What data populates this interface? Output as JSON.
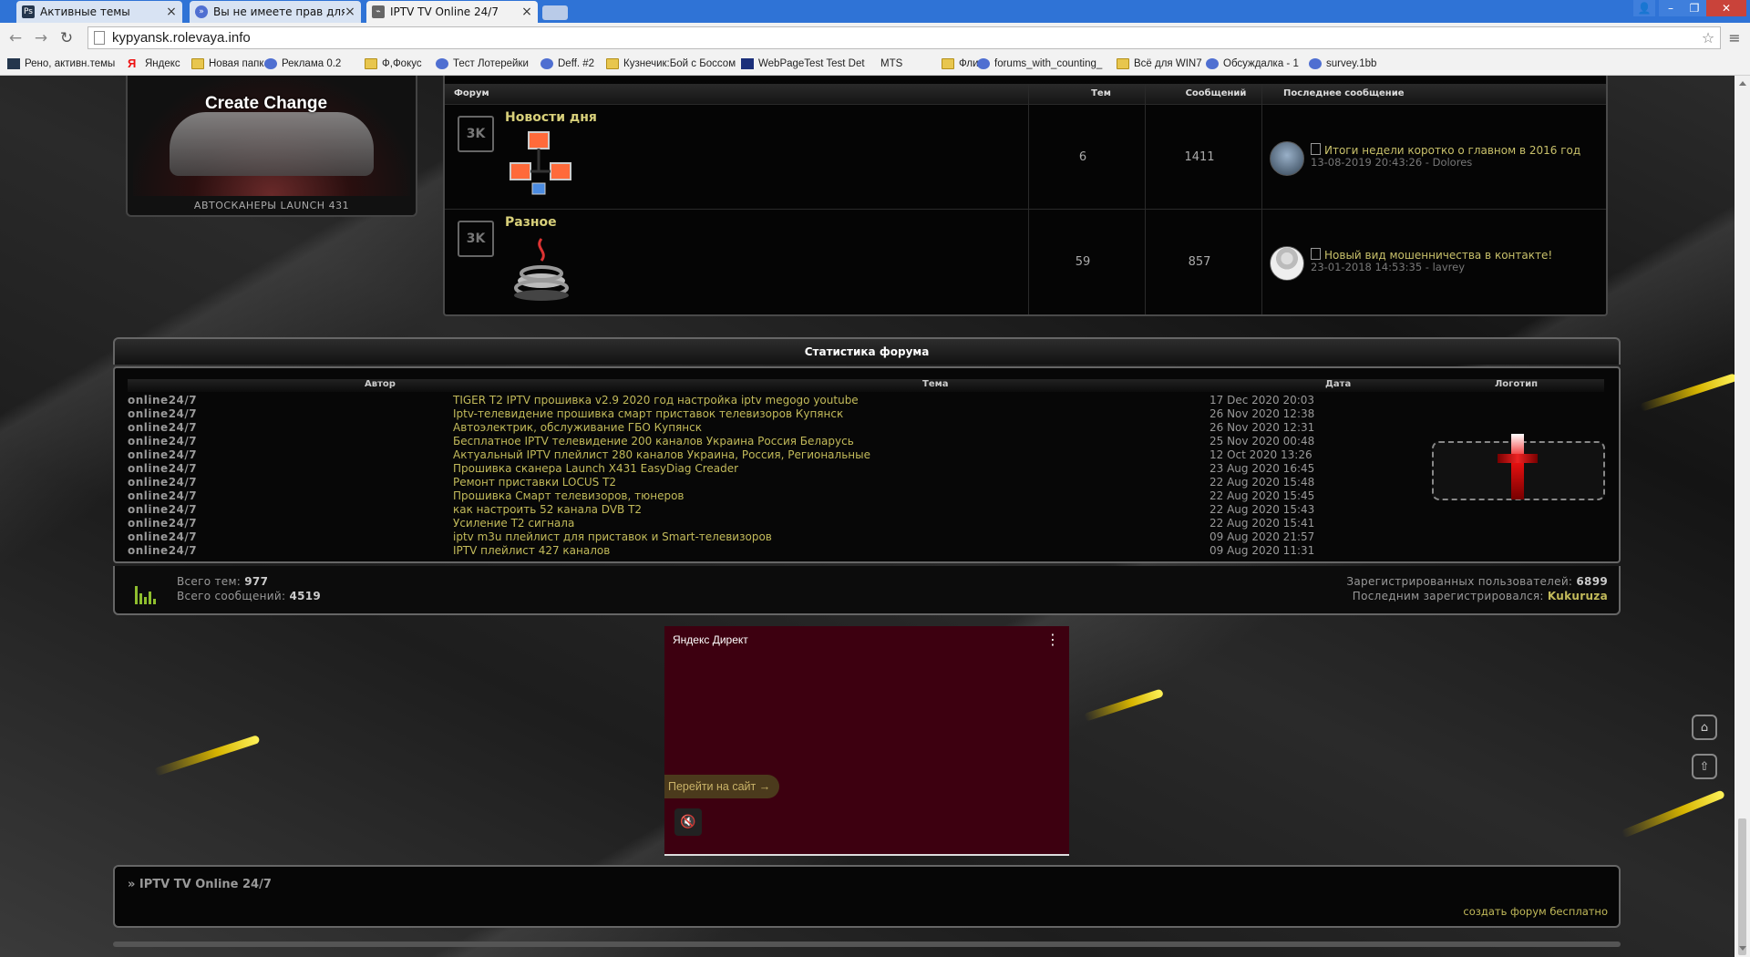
{
  "browser": {
    "tabs": [
      {
        "title": "Активные темы",
        "favicon": "ps-icon",
        "active": false
      },
      {
        "title": "Вы не имеете прав для дос",
        "favicon": "proxy-icon",
        "active": false
      },
      {
        "title": "IPTV TV Online 24/7",
        "favicon": "satellite-icon",
        "active": true
      }
    ],
    "url": "kypyansk.rolevaya.info",
    "bookmarks": [
      {
        "label": "Рено, активн.темы",
        "icon": "ps"
      },
      {
        "label": "Яндекс",
        "icon": "ya"
      },
      {
        "label": "Новая папка",
        "icon": "folder"
      },
      {
        "label": "Реклама 0.2",
        "icon": "proxy"
      },
      {
        "label": "Ф,Фокус",
        "icon": "folder"
      },
      {
        "label": "Тест Лотерейки",
        "icon": "proxy"
      },
      {
        "label": "Deff. #2",
        "icon": "proxy"
      },
      {
        "label": "Кузнечик:Бой с Боссом",
        "icon": "folder"
      },
      {
        "label": "WebPageTest Test Det",
        "icon": "wpt"
      },
      {
        "label": "MTS",
        "icon": "page"
      },
      {
        "label": "Фли",
        "icon": "folder"
      },
      {
        "label": "forums_with_counting_",
        "icon": "proxy"
      },
      {
        "label": "Всё для WIN7",
        "icon": "folder"
      },
      {
        "label": "Обсуждалка - 1",
        "icon": "proxy"
      },
      {
        "label": "survey.1bb",
        "icon": "proxy"
      }
    ]
  },
  "widget": {
    "caption": "Create Change",
    "subtitle": "АВТОСКАНЕРЫ LAUNCH 431"
  },
  "forum_table": {
    "headers": {
      "forum": "Форум",
      "topics": "Тем",
      "posts": "Сообщений",
      "last": "Последнее сообщение"
    },
    "rows": [
      {
        "name": "Новости дня",
        "icon_badge": "3K",
        "topics": "6",
        "posts": "1411",
        "last_title": "Итоги недели коротко о главном в 2016 год",
        "last_meta": "13-08-2019 20:43:26 - Dolores"
      },
      {
        "name": "Разное",
        "icon_badge": "3K",
        "topics": "59",
        "posts": "857",
        "last_title": "Новый вид мошенничества в контакте!",
        "last_meta": "23-01-2018 14:53:35 - lavrey"
      }
    ]
  },
  "stats": {
    "title": "Статистика форума",
    "headers": {
      "author": "Автор",
      "topic": "Тема",
      "date": "Дата",
      "logo": "Логотип"
    },
    "rows": [
      {
        "author": "online24/7",
        "topic": "TIGER T2 IPTV прошивка v2.9 2020 год настройка iptv megogo youtube",
        "date": "17 Dec 2020 20:03"
      },
      {
        "author": "online24/7",
        "topic": "Iptv-телевидение прошивка смарт приставок телевизоров Купянск",
        "date": "26 Nov 2020 12:38"
      },
      {
        "author": "online24/7",
        "topic": "Автоэлектрик, обслуживание ГБО Купянск",
        "date": "26 Nov 2020 12:31"
      },
      {
        "author": "online24/7",
        "topic": "Бесплатное IPTV телевидение 200 каналов Украина Россия Беларусь",
        "date": "25 Nov 2020 00:48"
      },
      {
        "author": "online24/7",
        "topic": "Актуальный IPTV плейлист 280 каналов Украина, Россия, Региональные",
        "date": "12 Oct 2020 13:26"
      },
      {
        "author": "online24/7",
        "topic": "Прошивка сканера Launch X431 EasyDiag Creader",
        "date": "23 Aug 2020 16:45"
      },
      {
        "author": "online24/7",
        "topic": "Ремонт приставки LOCUS T2",
        "date": "22 Aug 2020 15:48"
      },
      {
        "author": "online24/7",
        "topic": "Прошивка Смарт телевизоров, тюнеров",
        "date": "22 Aug 2020 15:45"
      },
      {
        "author": "online24/7",
        "topic": "как настроить 52 канала DVB T2",
        "date": "22 Aug 2020 15:43"
      },
      {
        "author": "online24/7",
        "topic": "Усиление Т2 сигнала",
        "date": "22 Aug 2020 15:41"
      },
      {
        "author": "online24/7",
        "topic": "iptv m3u плейлист для приставок и Smart-телевизоров",
        "date": "09 Aug 2020 21:57"
      },
      {
        "author": "online24/7",
        "topic": "IPTV плейлист 427 каналов",
        "date": "09 Aug 2020 11:31"
      }
    ],
    "totals": {
      "topics_label": "Всего тем:",
      "topics_value": "977",
      "posts_label": "Всего сообщений:",
      "posts_value": "4519",
      "users_label": "Зарегистрированных пользователей:",
      "users_value": "6899",
      "last_user_label": "Последним зарегистрировался:",
      "last_user_value": "Kukuruza"
    }
  },
  "ad": {
    "brand": "Яндекс Директ",
    "cta": "Перейти на сайт →"
  },
  "footer": {
    "title": "» IPTV TV Online 24/7",
    "create_link": "создать форум бесплатно"
  },
  "colors": {
    "accent_link": "#c2ba5a",
    "forum_title": "#d8d07a",
    "tab_bar": "#2f73d6",
    "ad_background": "#3d0010"
  }
}
